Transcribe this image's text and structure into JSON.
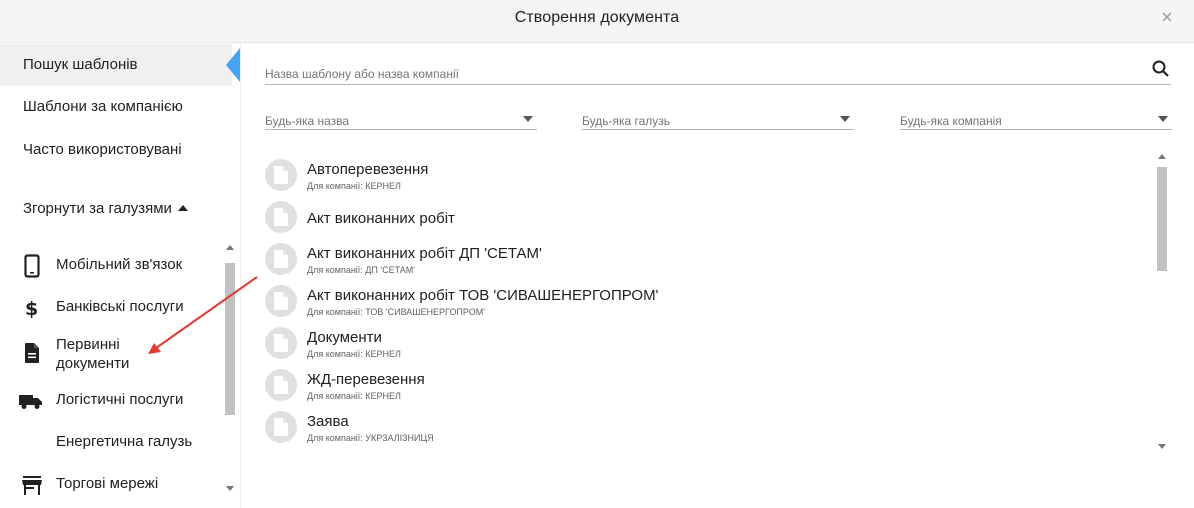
{
  "dialog": {
    "title": "Створення документа",
    "close_icon": "close-icon"
  },
  "sidebar": {
    "nav": [
      {
        "label": "Пошук шаблонів",
        "active": true
      },
      {
        "label": "Шаблони за компанією",
        "active": false
      },
      {
        "label": "Часто використовувані",
        "active": false
      }
    ],
    "collapse_label": "Згорнути за галузями",
    "categories": [
      {
        "label": "Мобільний зв'язок",
        "icon": "mobile-phone-icon"
      },
      {
        "label": "Банківські послуги",
        "icon": "dollar-icon"
      },
      {
        "label": "Первинні",
        "label2": "документи",
        "icon": "document-icon"
      },
      {
        "label": "Логістичні послуги",
        "icon": "truck-icon"
      },
      {
        "label": "Енергетична галузь",
        "icon": ""
      },
      {
        "label": "Торгові мережі",
        "icon": "store-icon"
      }
    ],
    "accent_color": "#42a5f5"
  },
  "search": {
    "placeholder": "Назва шаблону або назва компанії",
    "value": ""
  },
  "filters": [
    {
      "label": "Будь-яка назва"
    },
    {
      "label": "Будь-яка галузь"
    },
    {
      "label": "Будь-яка компанія"
    }
  ],
  "templates": [
    {
      "title": "Автоперевезення",
      "subtitle": "Для компанії: КЕРНЕЛ"
    },
    {
      "title": "Акт виконанних робіт",
      "subtitle": ""
    },
    {
      "title": "Акт виконанних робіт ДП 'СЕТАМ'",
      "subtitle": "Для компанії: ДП 'СЕТАМ'"
    },
    {
      "title": "Акт виконанних робіт ТОВ 'СИВАШЕНЕРГОПРОМ'",
      "subtitle": "Для компанії: ТОВ 'СИВАШЕНЕРГОПРОМ'"
    },
    {
      "title": "Документи",
      "subtitle": "Для компанії: КЕРНЕЛ"
    },
    {
      "title": "ЖД-перевезення",
      "subtitle": "Для компанії: КЕРНЕЛ"
    },
    {
      "title": "Заява",
      "subtitle": "Для компанії: УКРЗАЛІЗНИЦЯ"
    }
  ],
  "annotation_color": "#e53935"
}
